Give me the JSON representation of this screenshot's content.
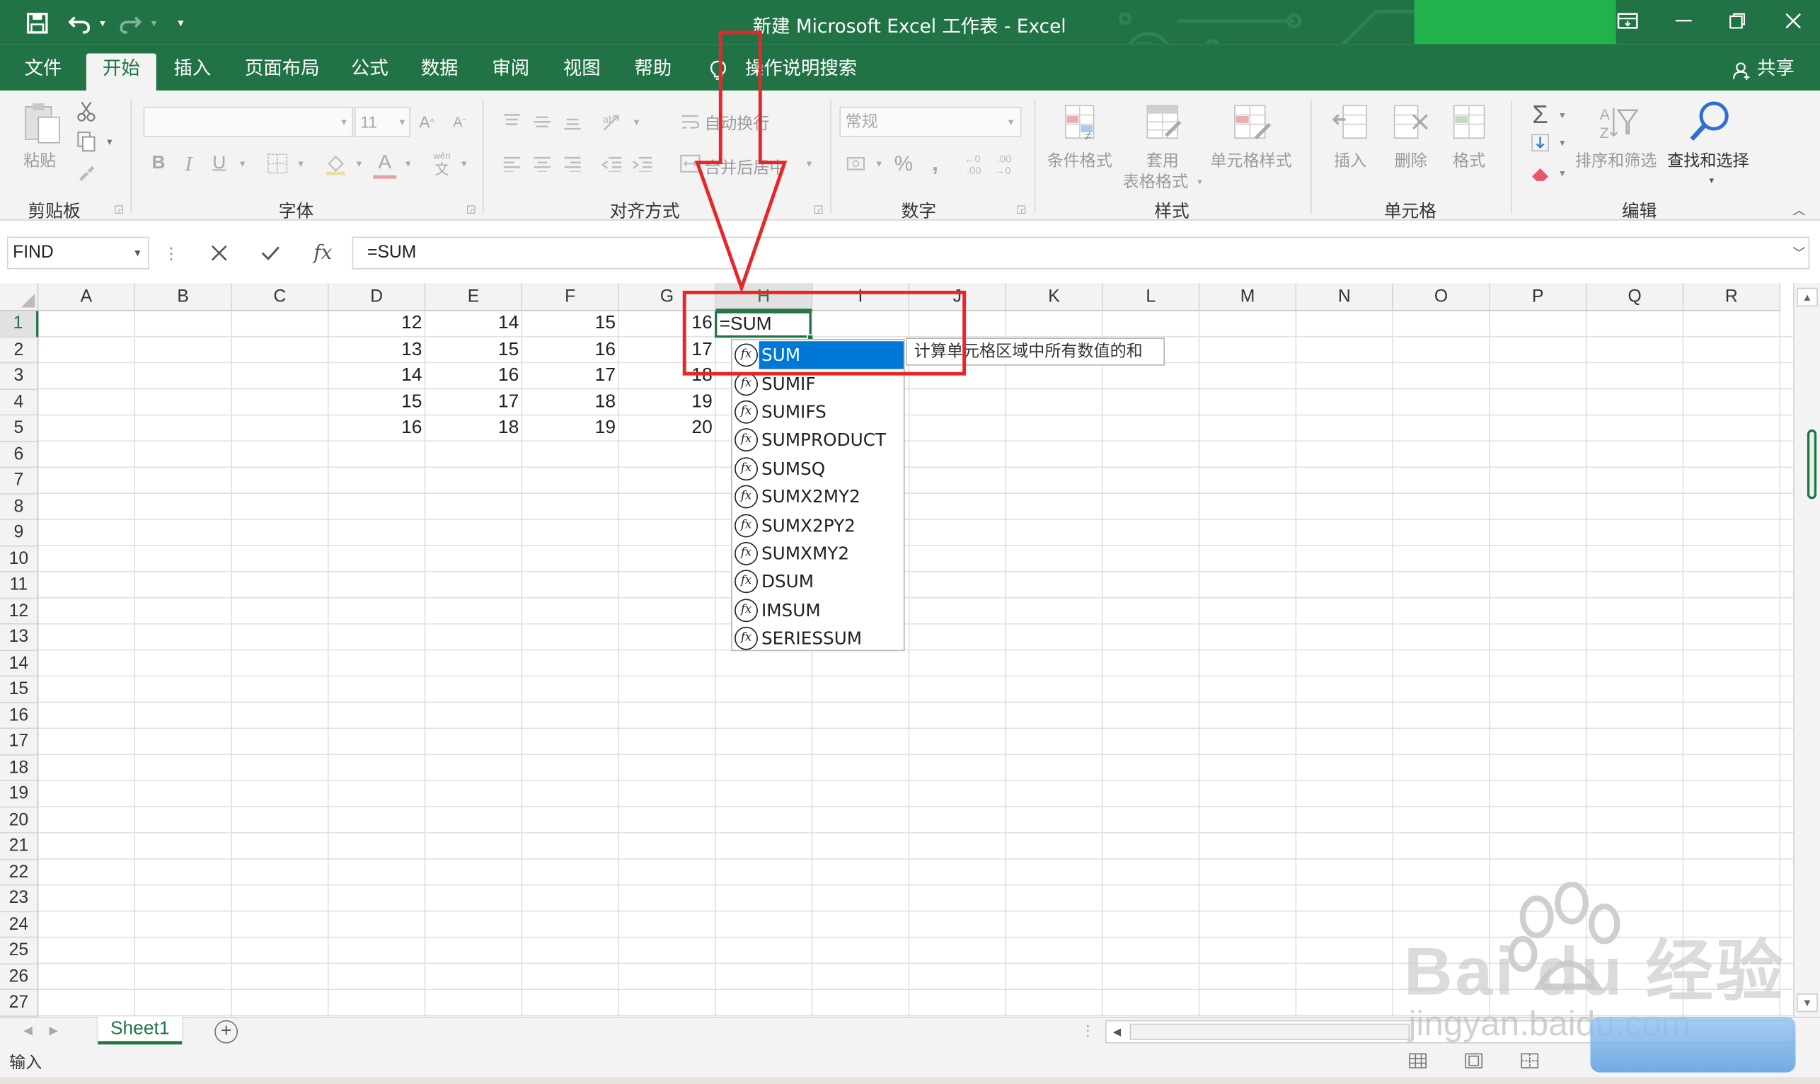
{
  "window": {
    "title": "新建 Microsoft Excel 工作表  -  Excel",
    "share_label": "共享"
  },
  "tabs": [
    "文件",
    "开始",
    "插入",
    "页面布局",
    "公式",
    "数据",
    "审阅",
    "视图",
    "帮助"
  ],
  "active_tab": "开始",
  "tell_me": "操作说明搜索",
  "ribbon": {
    "clipboard": {
      "paste": "粘贴",
      "group": "剪贴板"
    },
    "font": {
      "size": "11",
      "bold": "B",
      "italic": "I",
      "underline": "U",
      "font_color": "A",
      "phonetic_top": "wén",
      "phonetic_bottom": "文",
      "group": "字体"
    },
    "alignment": {
      "wrap": "自动换行",
      "merge": "合并后居中",
      "group": "对齐方式"
    },
    "number": {
      "format": "常规",
      "percent": "%",
      "comma": ",",
      "group": "数字"
    },
    "styles": {
      "conditional": "条件格式",
      "table_line1": "套用",
      "table_line2": "表格格式",
      "cell_styles": "单元格样式",
      "group": "样式"
    },
    "cells": {
      "insert": "插入",
      "delete": "删除",
      "format": "格式",
      "group": "单元格"
    },
    "editing": {
      "autosum": "Σ",
      "sort_filter": "排序和筛选",
      "find_select": "查找和选择",
      "group": "编辑"
    }
  },
  "formula_bar": {
    "name_box": "FIND",
    "fx": "fx",
    "formula": "=SUM"
  },
  "columns": [
    "A",
    "B",
    "C",
    "D",
    "E",
    "F",
    "G",
    "H",
    "I",
    "J",
    "K",
    "L",
    "M",
    "N",
    "O",
    "P",
    "Q",
    "R"
  ],
  "rows": [
    "1",
    "2",
    "3",
    "4",
    "5",
    "6",
    "7",
    "8",
    "9",
    "10",
    "11",
    "12",
    "13",
    "14",
    "15",
    "16",
    "17",
    "18",
    "19",
    "20",
    "21",
    "22",
    "23",
    "24",
    "25",
    "26",
    "27"
  ],
  "cells": {
    "D": [
      "12",
      "13",
      "14",
      "15",
      "16"
    ],
    "E": [
      "14",
      "15",
      "16",
      "17",
      "18"
    ],
    "F": [
      "15",
      "16",
      "17",
      "18",
      "19"
    ],
    "G": [
      "16",
      "17",
      "18",
      "19",
      "20"
    ]
  },
  "active_cell": {
    "value": "=SUM"
  },
  "autocomplete": {
    "items": [
      "SUM",
      "SUMIF",
      "SUMIFS",
      "SUMPRODUCT",
      "SUMSQ",
      "SUMX2MY2",
      "SUMX2PY2",
      "SUMXMY2",
      "DSUM",
      "IMSUM",
      "SERIESSUM"
    ],
    "selected": "SUM",
    "tooltip": "计算单元格区域中所有数值的和"
  },
  "sheet_tab": "Sheet1",
  "status": "输入",
  "watermark": {
    "line1": "Bai du 经验",
    "line2": "jingyan.baidu.com"
  },
  "colors": {
    "accent": "#217346",
    "highlight": "#e8262a",
    "selection": "#0078d7"
  }
}
